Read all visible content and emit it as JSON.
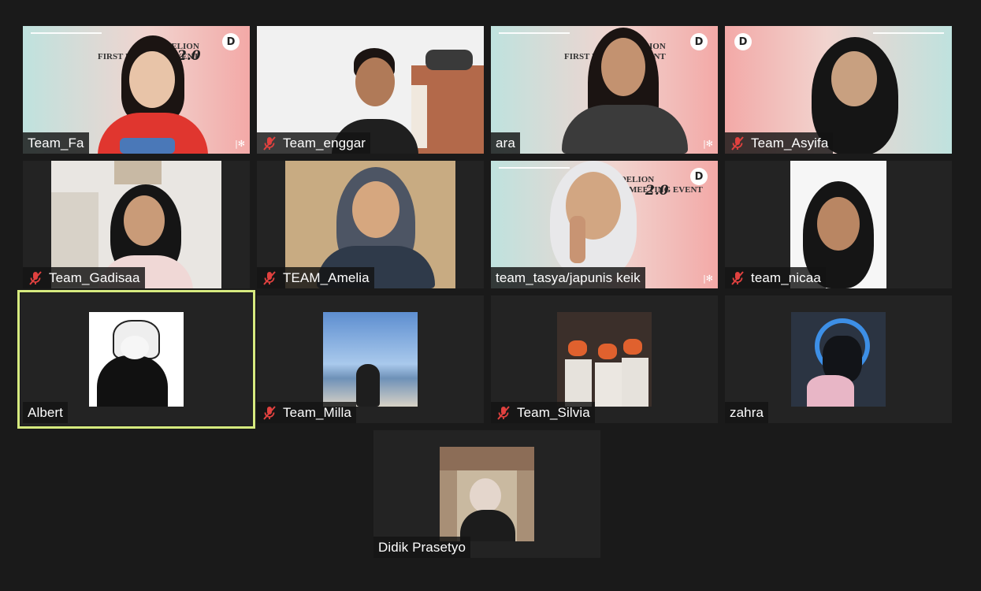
{
  "gallery": {
    "participants": [
      {
        "name": "Team_Fa",
        "muted": false
      },
      {
        "name": "Team_enggar",
        "muted": true
      },
      {
        "name": "ara",
        "muted": false
      },
      {
        "name": "Team_Asyifa",
        "muted": true
      },
      {
        "name": "Team_Gadisaa",
        "muted": true
      },
      {
        "name": "TEAM_Amelia",
        "muted": true
      },
      {
        "name": "team_tasya/japunis keik",
        "muted": false
      },
      {
        "name": "team_nicaa",
        "muted": true
      },
      {
        "name": "Albert",
        "muted": false,
        "active_speaker": true
      },
      {
        "name": "Team_Milla",
        "muted": true
      },
      {
        "name": "Team_Silvia",
        "muted": true
      },
      {
        "name": "zahra",
        "muted": false
      },
      {
        "name": "Didik Prasetyo",
        "muted": false
      }
    ],
    "banner": {
      "line1": "DANDELION",
      "line2": "FIRST MEETING EVENT",
      "script": "2.0",
      "logo": "D"
    }
  },
  "colors": {
    "background": "#1a1a1a",
    "tile": "#232323",
    "active_speaker_border": "#d6ea7f",
    "muted_icon": "#e0413f",
    "name_text": "#ffffff"
  },
  "icons": {
    "muted": "microphone-muted-icon",
    "logo": "event-logo-icon"
  }
}
